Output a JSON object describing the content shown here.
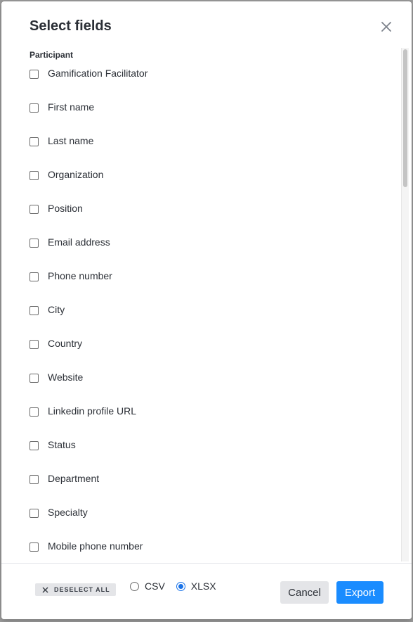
{
  "dialog": {
    "title": "Select fields",
    "close_icon": "close-icon"
  },
  "section": {
    "label": "Participant"
  },
  "fields": [
    {
      "label": "Gamification Facilitator",
      "checked": false
    },
    {
      "label": "First name",
      "checked": false
    },
    {
      "label": "Last name",
      "checked": false
    },
    {
      "label": "Organization",
      "checked": false
    },
    {
      "label": "Position",
      "checked": false
    },
    {
      "label": "Email address",
      "checked": false
    },
    {
      "label": "Phone number",
      "checked": false
    },
    {
      "label": "City",
      "checked": false
    },
    {
      "label": "Country",
      "checked": false
    },
    {
      "label": "Website",
      "checked": false
    },
    {
      "label": "Linkedin profile URL",
      "checked": false
    },
    {
      "label": "Status",
      "checked": false
    },
    {
      "label": "Department",
      "checked": false
    },
    {
      "label": "Specialty",
      "checked": false
    },
    {
      "label": "Mobile phone number",
      "checked": false
    }
  ],
  "footer": {
    "deselect_all_label": "DESELECT ALL",
    "format_options": [
      {
        "label": "CSV",
        "selected": false
      },
      {
        "label": "XLSX",
        "selected": true
      }
    ],
    "cancel_label": "Cancel",
    "export_label": "Export"
  },
  "colors": {
    "primary": "#1a8cff",
    "radio_selected": "#1a73e8",
    "text": "#2b2f36",
    "secondary_button": "#e4e5e8"
  }
}
